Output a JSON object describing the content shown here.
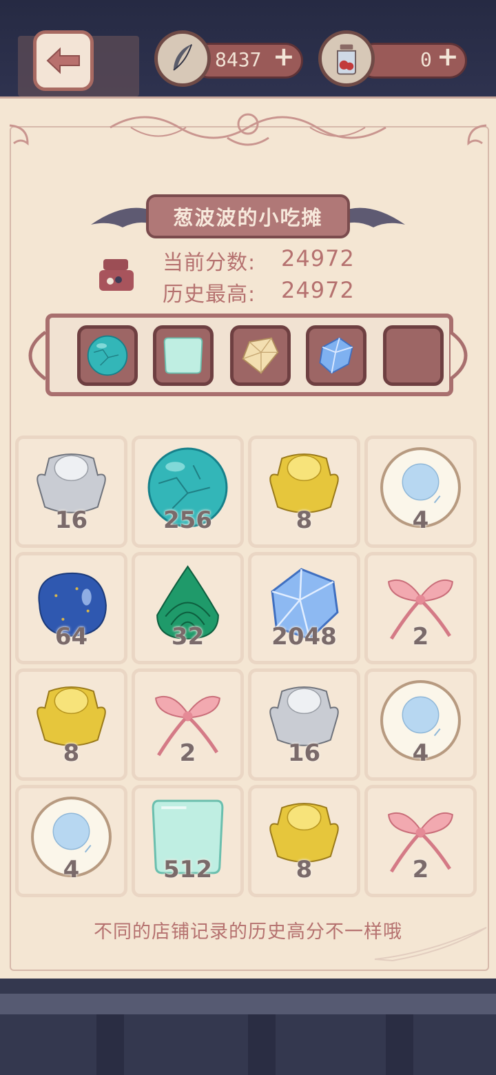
{
  "top": {
    "feather_count": "8437",
    "jar_count": "0",
    "plus_label": "+"
  },
  "stall": {
    "name": "葱波波的小吃摊",
    "current_label": "当前分数:",
    "current_score": "24972",
    "best_label": "历史最高:",
    "best_score": "24972"
  },
  "slots": [
    "turquoise",
    "aquamarine-block",
    "citrine",
    "sapphire",
    "empty"
  ],
  "board": [
    {
      "gem": "silver-ingot",
      "value": "16"
    },
    {
      "gem": "turquoise",
      "value": "256"
    },
    {
      "gem": "gold-ingot",
      "value": "8"
    },
    {
      "gem": "pearl",
      "value": "4"
    },
    {
      "gem": "lapis",
      "value": "64"
    },
    {
      "gem": "malachite",
      "value": "32"
    },
    {
      "gem": "sapphire",
      "value": "2048"
    },
    {
      "gem": "ribbon",
      "value": "2"
    },
    {
      "gem": "gold-ingot",
      "value": "8"
    },
    {
      "gem": "ribbon",
      "value": "2"
    },
    {
      "gem": "silver-ingot",
      "value": "16"
    },
    {
      "gem": "pearl",
      "value": "4"
    },
    {
      "gem": "pearl",
      "value": "4"
    },
    {
      "gem": "aquamarine-block",
      "value": "512"
    },
    {
      "gem": "gold-ingot",
      "value": "8"
    },
    {
      "gem": "ribbon",
      "value": "2"
    }
  ],
  "hint": "不同的店铺记录的历史高分不一样哦",
  "colors": {
    "panel": "#f4e6d3",
    "accent": "#b5716f",
    "frame": "#a86f6e",
    "night": "#2b2d45"
  }
}
